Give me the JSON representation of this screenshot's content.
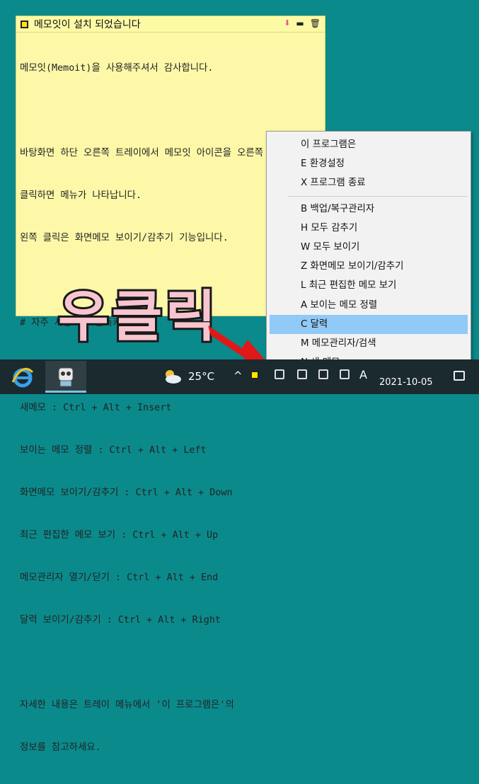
{
  "note": {
    "title": "메모잇이 설치 되었습니다",
    "controls": {
      "pin": "⬇",
      "minimize": "▬",
      "delete": "🗑"
    },
    "lines": [
      "메모잇(Memoit)을 사용해주셔서 감사합니다.",
      "",
      "바탕화면 하단 오른쪽 트레이에서 메모잇 아이콘을 오른쪽",
      "클릭하면 메뉴가 나타납니다.",
      "왼쪽 클릭은 화면메모 보이기/감추기 기능입니다.",
      "",
      "# 자주 사용하는 단축키 #",
      "",
      "새메모 : Ctrl + Alt + Insert",
      "보이는 메모 정렬 : Ctrl + Alt + Left",
      "화면메모 보이기/감추기 : Ctrl + Alt + Down",
      "최근 편집한 메모 보기 : Ctrl + Alt + Up",
      "메모관리자 열기/닫기 : Ctrl + Alt + End",
      "달력 보이기/감추기 : Ctrl + Alt + Right",
      "",
      "자세한 내용은 트레이 메뉴에서 '이 프로그램은'의",
      "정보를 참고하세요."
    ]
  },
  "overlay_label": "우클릭",
  "menu": {
    "group1": [
      "이 프로그램은",
      "E 환경설정",
      "X 프로그램 종료"
    ],
    "group2": [
      "B 백업/복구관리자",
      "H 모두 감추기",
      "W 모두 보이기",
      "Z 화면메모 보이기/감추기",
      "L 최근 편집한 메모 보기",
      "A 보이는 메모 정렬",
      "C 달력",
      "M 메모관리자/검색",
      "N 새 메모"
    ],
    "highlighted": "C 달력"
  },
  "taskbar": {
    "temperature": "25°C",
    "chevron": "^",
    "ime": "A",
    "date": "2021-10-05"
  },
  "icons": [
    "ie-icon",
    "app-icon",
    "weather-icon",
    "memo-tray-icon",
    "notification-icon"
  ],
  "colors": {
    "desktop": "#0b8a8c",
    "note_bg": "#fcf8a8",
    "highlight": "#91c9f7",
    "arrow": "#e01818"
  }
}
